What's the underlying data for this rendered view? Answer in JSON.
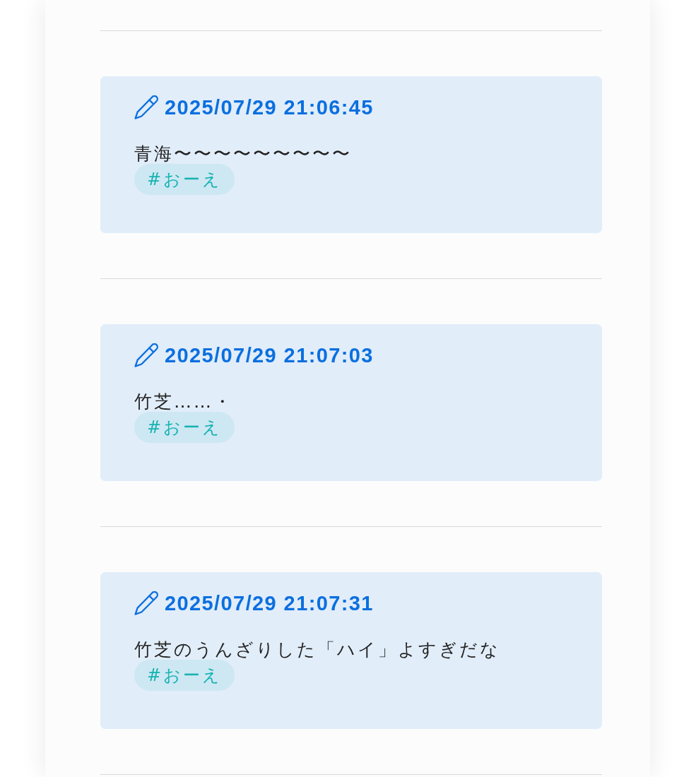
{
  "posts": [
    {
      "timestamp": "2025/07/29 21:06:45",
      "text": "青海〜〜〜〜〜〜〜〜〜",
      "tags": [
        "#おーえ"
      ]
    },
    {
      "timestamp": "2025/07/29 21:07:03",
      "text": "竹芝……・",
      "tags": [
        "#おーえ"
      ]
    },
    {
      "timestamp": "2025/07/29 21:07:31",
      "text": "竹芝のうんざりした「ハイ」よすぎだな",
      "tags": [
        "#おーえ"
      ]
    }
  ]
}
